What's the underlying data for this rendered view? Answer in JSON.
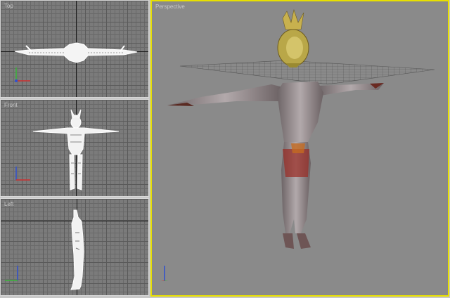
{
  "viewports": {
    "top": {
      "label": "Top"
    },
    "front": {
      "label": "Front"
    },
    "left": {
      "label": "Left"
    },
    "perspective": {
      "label": "Perspective",
      "active": true
    }
  },
  "colors": {
    "active_border": "#e8e000",
    "grid_bg": "#7b7b7b",
    "perspective_bg": "#8a8a8a"
  }
}
